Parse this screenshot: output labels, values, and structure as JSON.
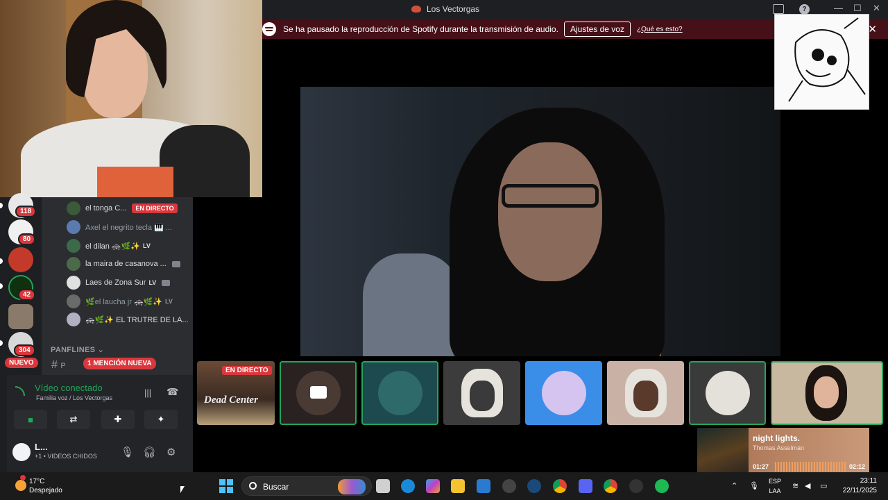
{
  "window": {
    "title": "Los Vectorgas"
  },
  "notice": {
    "message": "Se ha pausado la reproducción de Spotify durante la transmisión de audio.",
    "button": "Ajustes de voz",
    "link": "¿Qué es esto?",
    "close": "✕"
  },
  "rail": {
    "badges": [
      "118",
      "80",
      "42",
      "304"
    ],
    "new_pill": "NUEVO"
  },
  "channels": {
    "members": [
      {
        "name": "el tonga C...",
        "tag": "EN DIRECTO"
      },
      {
        "name": "Axel el negrito tecla 🎹 ..."
      },
      {
        "name": "el dilan 🚓🌿✨",
        "tag": "LV"
      },
      {
        "name": "la maira de casanova ..."
      },
      {
        "name": "Laes de Zona Sur",
        "tag": "LV"
      },
      {
        "name": "🌿el laucha jr 🚓🌿✨",
        "tag": "LV"
      },
      {
        "name": "🚓🌿✨ EL TRUTRE DE LA..."
      }
    ],
    "category": "PANFLINES",
    "category_chevron": "⌄",
    "hash": "#",
    "channel_prefix": "P",
    "mention": "1 MENCIÓN NUEVA"
  },
  "voice": {
    "status": "Vídeo conectado",
    "location": "Familia voz / Los Vectorgas"
  },
  "user": {
    "name": "L...",
    "status": "+1 • VIDEOS CHIDOS"
  },
  "strip": {
    "live_tag": "EN DIRECTO",
    "poster_title": "Dead Center"
  },
  "now_playing": {
    "song": "night lights.",
    "artist": "Thomas Asselman",
    "elapsed": "01:27",
    "total": "02:12",
    "progress": 0.66
  },
  "taskbar": {
    "temp": "17°C",
    "weather": "Despejado",
    "search_placeholder": "Buscar",
    "lang_top": "ESP",
    "lang_bottom": "LAA",
    "time": "23:11",
    "date": "22/11/2025"
  },
  "colors": {
    "accent_green": "#23a55a",
    "danger_red": "#da373c",
    "notice_bg": "#461018"
  }
}
